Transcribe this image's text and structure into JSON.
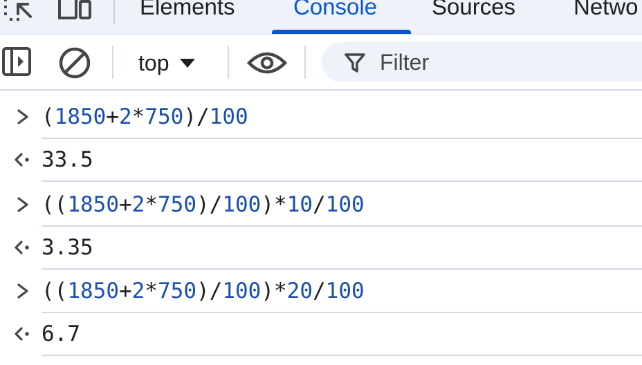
{
  "tabs": [
    {
      "label": "Elements",
      "active": false
    },
    {
      "label": "Console",
      "active": true
    },
    {
      "label": "Sources",
      "active": false
    },
    {
      "label": "Netwo",
      "active": false
    }
  ],
  "toolbar": {
    "context_value": "top",
    "filter_placeholder": "Filter"
  },
  "console": {
    "entries": [
      {
        "kind": "input",
        "tokens": [
          [
            "op",
            "("
          ],
          [
            "num",
            "1850"
          ],
          [
            "op",
            "+"
          ],
          [
            "num",
            "2"
          ],
          [
            "op",
            "*"
          ],
          [
            "num",
            "750"
          ],
          [
            "op",
            ")/"
          ],
          [
            "num",
            "100"
          ]
        ]
      },
      {
        "kind": "output",
        "value": "33.5"
      },
      {
        "kind": "input",
        "tokens": [
          [
            "op",
            "(("
          ],
          [
            "num",
            "1850"
          ],
          [
            "op",
            "+"
          ],
          [
            "num",
            "2"
          ],
          [
            "op",
            "*"
          ],
          [
            "num",
            "750"
          ],
          [
            "op",
            ")/"
          ],
          [
            "num",
            "100"
          ],
          [
            "op",
            ")*"
          ],
          [
            "num",
            "10"
          ],
          [
            "op",
            "/"
          ],
          [
            "num",
            "100"
          ]
        ]
      },
      {
        "kind": "output",
        "value": "3.35"
      },
      {
        "kind": "input",
        "tokens": [
          [
            "op",
            "(("
          ],
          [
            "num",
            "1850"
          ],
          [
            "op",
            "+"
          ],
          [
            "num",
            "2"
          ],
          [
            "op",
            "*"
          ],
          [
            "num",
            "750"
          ],
          [
            "op",
            ")/"
          ],
          [
            "num",
            "100"
          ],
          [
            "op",
            ")*"
          ],
          [
            "num",
            "20"
          ],
          [
            "op",
            "/"
          ],
          [
            "num",
            "100"
          ]
        ]
      },
      {
        "kind": "output",
        "value": "6.7"
      }
    ]
  },
  "colors": {
    "accent": "#0b57d0",
    "number": "#1a4fb0",
    "result": "#1a3d8f",
    "tabbar_bg": "#eef2f9"
  }
}
